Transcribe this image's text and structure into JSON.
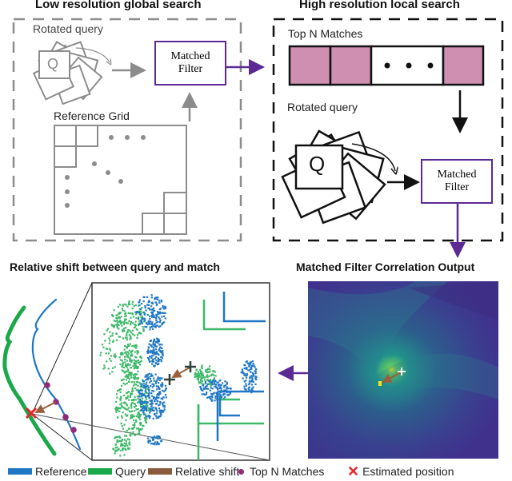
{
  "panels": {
    "low_res": {
      "title": "Low resolution global search",
      "rotated_query_label": "Rotated query",
      "query_glyph": "Q",
      "matched_filter": [
        "Matched",
        "Filter"
      ],
      "reference_grid_label": "Reference Grid"
    },
    "high_res": {
      "title": "High resolution local search",
      "top_n_label": "Top N Matches",
      "top_n_cells": [
        "match",
        "match",
        "ellipsis",
        "match"
      ],
      "ellipsis": "• • •",
      "rotated_query_label": "Rotated query",
      "query_glyph": "Q",
      "matched_filter": [
        "Matched",
        "Filter"
      ]
    },
    "relative_shift": {
      "title": "Relative shift between query and match"
    },
    "correlation": {
      "title": "Matched Filter Correlation Output"
    }
  },
  "legend": [
    {
      "type": "swatch",
      "label": "Reference",
      "color": "#1f77c4"
    },
    {
      "type": "swatch",
      "label": "Query",
      "color": "#1aa84a"
    },
    {
      "type": "swatch",
      "label": "Relative shift",
      "color": "#8b5a3c"
    },
    {
      "type": "dot",
      "label": "Top N Matches",
      "color": "#8e2a77"
    },
    {
      "type": "x",
      "label": "Estimated position",
      "color": "#e8232a",
      "glyph": "✕"
    }
  ],
  "colors": {
    "purple": "#5b2a93",
    "gray": "#8c8c8c",
    "pink": "#cf8fb1",
    "reference_blue": "#1f77c4",
    "query_green": "#3cb868",
    "shift_brown": "#9a5f3a",
    "match_purple": "#8e2a77",
    "estimate_red": "#e8232a"
  }
}
